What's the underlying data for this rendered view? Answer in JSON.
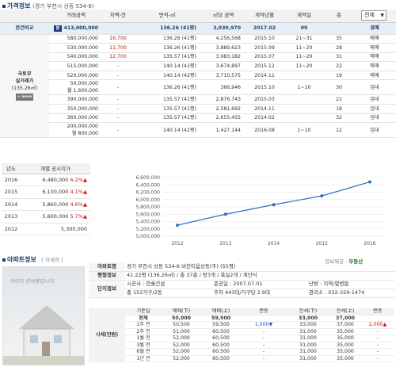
{
  "section1": {
    "title": "가격정보",
    "address": "(경기 부천시 상동 534-6)",
    "filter_selected": "전체",
    "columns": [
      "거래금액",
      "차액-만",
      "면적-㎡",
      "㎡당 금액",
      "계약년월",
      "계약일",
      "층"
    ],
    "compare": {
      "label": "본건비교",
      "price": "413,000,000",
      "diff": "",
      "area": "136.26 (41평)",
      "per_m2": "3,030,970",
      "ym": "2017.02",
      "day": "09",
      "floor": "",
      "kind": "경매",
      "tag": "본"
    },
    "side_label_1": "국토부",
    "side_label_2": "실거래가",
    "side_label_3": "(135.26㎡)",
    "side_more": "+ more",
    "rows": [
      {
        "price": "580,000,000",
        "diff": "16,700",
        "area": "136.26 (41평)",
        "per_m2": "4,256,568",
        "ym": "2015.10",
        "day": "21~31",
        "floor": "35",
        "kind": "매매"
      },
      {
        "price": "530,000,000",
        "diff": "11,700",
        "area": "136.26 (41평)",
        "per_m2": "3,889,623",
        "ym": "2015.09",
        "day": "11~20",
        "floor": "28",
        "kind": "매매"
      },
      {
        "price": "540,000,000",
        "diff": "12,700",
        "area": "135.57 (41평)",
        "per_m2": "3,983,182",
        "ym": "2015.07",
        "day": "11~20",
        "floor": "31",
        "kind": "매매"
      },
      {
        "price": "515,000,000",
        "diff": "-",
        "area": "140.14 (42평)",
        "per_m2": "3,674,897",
        "ym": "2015.12",
        "day": "11~20",
        "floor": "22",
        "kind": "매매"
      },
      {
        "price": "520,000,000",
        "diff": "-",
        "area": "140.14 (42평)",
        "per_m2": "3,710,575",
        "ym": "2014.11",
        "day": "",
        "floor": "19",
        "kind": "매매"
      },
      {
        "price": "50,000,000",
        "price2": "월 1,600,000",
        "diff": "-",
        "area": "136.26 (41평)",
        "per_m2": "366,946",
        "ym": "2015.10",
        "day": "1~10",
        "floor": "30",
        "kind": "임대"
      },
      {
        "price": "390,000,000",
        "diff": "-",
        "area": "135.57 (41평)",
        "per_m2": "2,876,743",
        "ym": "2015.03",
        "day": "",
        "floor": "21",
        "kind": "임대"
      },
      {
        "price": "350,000,000",
        "diff": "-",
        "area": "135.57 (41평)",
        "per_m2": "2,581,692",
        "ym": "2014.11",
        "day": "",
        "floor": "18",
        "kind": "임대"
      },
      {
        "price": "360,000,000",
        "diff": "-",
        "area": "135.57 (41평)",
        "per_m2": "2,655,455",
        "ym": "2014.02",
        "day": "",
        "floor": "32",
        "kind": "임대"
      },
      {
        "price": "200,000,000",
        "price2": "월 800,000",
        "diff": "-",
        "area": "140.14 (42평)",
        "per_m2": "1,427,144",
        "ym": "2016.08",
        "day": "1~10",
        "floor": "12",
        "kind": "임대"
      }
    ]
  },
  "official": {
    "col_year": "년도",
    "col_price": "개별 공시지가",
    "rows": [
      {
        "year": "2016",
        "price": "6,480,000",
        "pct": "6.2%"
      },
      {
        "year": "2015",
        "price": "6,100,000",
        "pct": "4.1%"
      },
      {
        "year": "2014",
        "price": "5,860,000",
        "pct": "4.6%"
      },
      {
        "year": "2013",
        "price": "5,600,000",
        "pct": "5.7%"
      },
      {
        "year": "2012",
        "price": "5,300,000",
        "pct": ""
      }
    ]
  },
  "chart_data": {
    "type": "line",
    "x": [
      "2012",
      "2013",
      "2014",
      "2015",
      "2016"
    ],
    "series": [
      {
        "values": [
          5300000,
          5600000,
          5860000,
          6100000,
          6480000
        ]
      }
    ],
    "y_ticks": [
      "5,000,000",
      "5,200,000",
      "5,400,000",
      "5,600,000",
      "5,800,000",
      "6,000,000",
      "6,200,000",
      "6,400,000",
      "6,600,000"
    ],
    "ylim": [
      5000000,
      6600000
    ],
    "grid": true,
    "color": "#2e6fc4"
  },
  "section2": {
    "title": "아파트정보",
    "detail_link": "[ 자세히 ]",
    "source_label": "정보제공 :",
    "source_name": "부동산",
    "photo_caption": "이미지 준비중입니다.",
    "info": [
      {
        "k": "아파트명",
        "v": "경기 부천시 상동 534-6 비잔티움상동(주) (55평)"
      },
      {
        "k": "평형정보",
        "v": "41.22평 (136.26㎡) / 총 37층 / 방3개 / 욕실2개 / 계단식"
      },
      {
        "k": "단지정보",
        "v": "시공사 : 한솔건설",
        "v2": "준공일 : 2007.07.01",
        "v3": "난방 : 지역/열병합"
      },
      {
        "k": "",
        "v": "총 152가구/2동",
        "v2": "주차 443대/가구당 2.9대",
        "v3": "관리소 : 032-329-1474"
      }
    ],
    "sise_label": "시세(만원)",
    "sise_cols": [
      "기준일",
      "매매(下)",
      "매매(上)",
      "변동",
      "전세(下)",
      "전세(上)",
      "변동"
    ],
    "sise_rows": [
      {
        "d": "현재",
        "a": "50,000",
        "b": "59,500",
        "c": "",
        "e": "33,000",
        "f": "37,000",
        "g": ""
      },
      {
        "d": "1주 전",
        "a": "50,500",
        "b": "59,500",
        "c": "1,000▼",
        "e": "33,000",
        "f": "37,000",
        "g": "2,000▲"
      },
      {
        "d": "2주 전",
        "a": "51,000",
        "b": "60,500",
        "c": "-",
        "e": "31,000",
        "f": "35,000",
        "g": "-"
      },
      {
        "d": "1월 전",
        "a": "52,000",
        "b": "60,500",
        "c": "-",
        "e": "31,000",
        "f": "35,000",
        "g": "-"
      },
      {
        "d": "3월 전",
        "a": "52,000",
        "b": "60,500",
        "c": "-",
        "e": "31,000",
        "f": "35,000",
        "g": "-"
      },
      {
        "d": "6월 전",
        "a": "52,000",
        "b": "60,500",
        "c": "-",
        "e": "31,000",
        "f": "35,000",
        "g": "-"
      },
      {
        "d": "1년 전",
        "a": "52,000",
        "b": "60,500",
        "c": "-",
        "e": "31,000",
        "f": "35,000",
        "g": "-"
      }
    ]
  }
}
